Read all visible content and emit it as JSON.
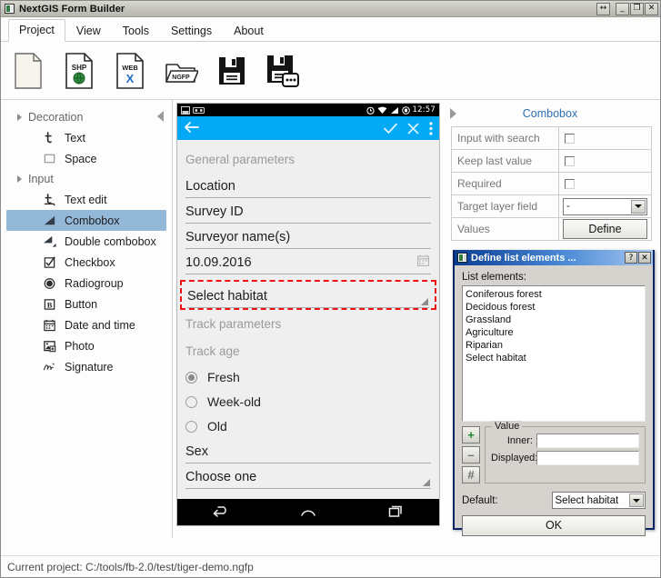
{
  "window": {
    "title": "NextGIS Form Builder",
    "app_icon": "app-logo-icon",
    "controls": [
      {
        "name": "resize-button",
        "glyph": "↔"
      },
      {
        "name": "minimize-button",
        "glyph": "_"
      },
      {
        "name": "maximize-button",
        "glyph": "❐"
      },
      {
        "name": "close-button",
        "glyph": "✕"
      }
    ]
  },
  "menu": {
    "tabs": [
      {
        "label": "Project",
        "active": true
      },
      {
        "label": "View",
        "active": false
      },
      {
        "label": "Tools",
        "active": false
      },
      {
        "label": "Settings",
        "active": false
      },
      {
        "label": "About",
        "active": false
      }
    ]
  },
  "toolbar": {
    "buttons": [
      {
        "name": "new-project-button",
        "icon": "blank-document-icon",
        "label": ""
      },
      {
        "name": "import-shp-button",
        "icon": "shp-document-icon",
        "label": "SHP"
      },
      {
        "name": "import-web-button",
        "icon": "web-document-icon",
        "label": "WEB"
      },
      {
        "name": "open-ngfp-button",
        "icon": "ngfp-folder-icon",
        "label": "NGFP"
      },
      {
        "name": "save-button",
        "icon": "floppy-save-icon",
        "label": ""
      },
      {
        "name": "save-as-button",
        "icon": "floppy-save-as-icon",
        "label": ""
      }
    ]
  },
  "sidebar": {
    "collapse_icon": "collapse-left-panel-icon",
    "groups": [
      {
        "label": "Decoration",
        "items": [
          {
            "label": "Text",
            "icon": "text-icon",
            "selected": false
          },
          {
            "label": "Space",
            "icon": "space-icon",
            "selected": false
          }
        ]
      },
      {
        "label": "Input",
        "items": [
          {
            "label": "Text edit",
            "icon": "text-edit-icon",
            "selected": false
          },
          {
            "label": "Combobox",
            "icon": "combobox-icon",
            "selected": true
          },
          {
            "label": "Double combobox",
            "icon": "double-combobox-icon",
            "selected": false
          },
          {
            "label": "Checkbox",
            "icon": "checkbox-icon",
            "selected": false
          },
          {
            "label": "Radiogroup",
            "icon": "radiogroup-icon",
            "selected": false
          },
          {
            "label": "Button",
            "icon": "button-icon",
            "selected": false
          },
          {
            "label": "Date and time",
            "icon": "calendar-icon",
            "selected": false
          },
          {
            "label": "Photo",
            "icon": "photo-icon",
            "selected": false
          },
          {
            "label": "Signature",
            "icon": "signature-icon",
            "selected": false
          }
        ]
      }
    ]
  },
  "phone": {
    "status": {
      "time": "12:57",
      "icons": [
        "screenshot-icon",
        "usb-icon",
        "alarm-icon",
        "wifi-icon",
        "signal-icon",
        "battery-icon"
      ]
    },
    "actionbar": {
      "back_icon": "back-arrow-icon",
      "accept_icon": "check-icon",
      "cancel_icon": "close-icon",
      "overflow_icon": "overflow-menu-icon",
      "accent_color": "#03a9f4"
    },
    "form": {
      "caption_general": "General parameters",
      "field_location": "Location",
      "field_survey_id": "Survey ID",
      "field_surveyor": "Surveyor name(s)",
      "field_date": "10.09.2016",
      "combobox_selected": "Select habitat",
      "caption_track": "Track parameters",
      "caption_track_age": "Track age",
      "radios": [
        {
          "label": "Fresh",
          "checked": true
        },
        {
          "label": "Week-old",
          "checked": false
        },
        {
          "label": "Old",
          "checked": false
        }
      ],
      "field_sex": "Sex",
      "field_choose": "Choose one",
      "highlight_color": "#ee1111"
    },
    "navbar": {
      "back_icon": "nav-back-icon",
      "home_icon": "nav-home-icon",
      "recents_icon": "nav-recents-icon"
    }
  },
  "properties": {
    "expand_icon": "expand-panel-icon",
    "title": "Combobox",
    "title_color": "#2d6fb5",
    "rows": [
      {
        "label": "Input with search",
        "type": "checkbox",
        "value": false
      },
      {
        "label": "Keep last value",
        "type": "checkbox",
        "value": false
      },
      {
        "label": "Required",
        "type": "checkbox",
        "value": false
      },
      {
        "label": "Target layer field",
        "type": "select",
        "value": "-"
      },
      {
        "label": "Values",
        "type": "button",
        "value": "Define"
      }
    ]
  },
  "dialog": {
    "title": "Define list elements ...",
    "icon": "dialog-app-icon",
    "help_glyph": "?",
    "close_glyph": "✕",
    "list_label": "List elements:",
    "list_items": [
      "Coniferous forest",
      "Decidous forest",
      "Grassland",
      "Agriculture",
      "Riparian",
      "Select habitat"
    ],
    "side_buttons": [
      {
        "name": "add-item-button",
        "glyph": "+",
        "color": "#1a8a2a"
      },
      {
        "name": "remove-item-button",
        "glyph": "–",
        "color": "#6f6f6f"
      },
      {
        "name": "renumber-items-button",
        "glyph": "#",
        "color": "#6f6f6f"
      }
    ],
    "value_group": {
      "legend": "Value",
      "inner_label": "Inner:",
      "inner_value": "",
      "displayed_label": "Displayed:",
      "displayed_value": ""
    },
    "default_label": "Default:",
    "default_value": "Select habitat",
    "ok_label": "OK"
  },
  "statusbar": {
    "text": "Current project: C:/tools/fb-2.0/test/tiger-demo.ngfp"
  }
}
